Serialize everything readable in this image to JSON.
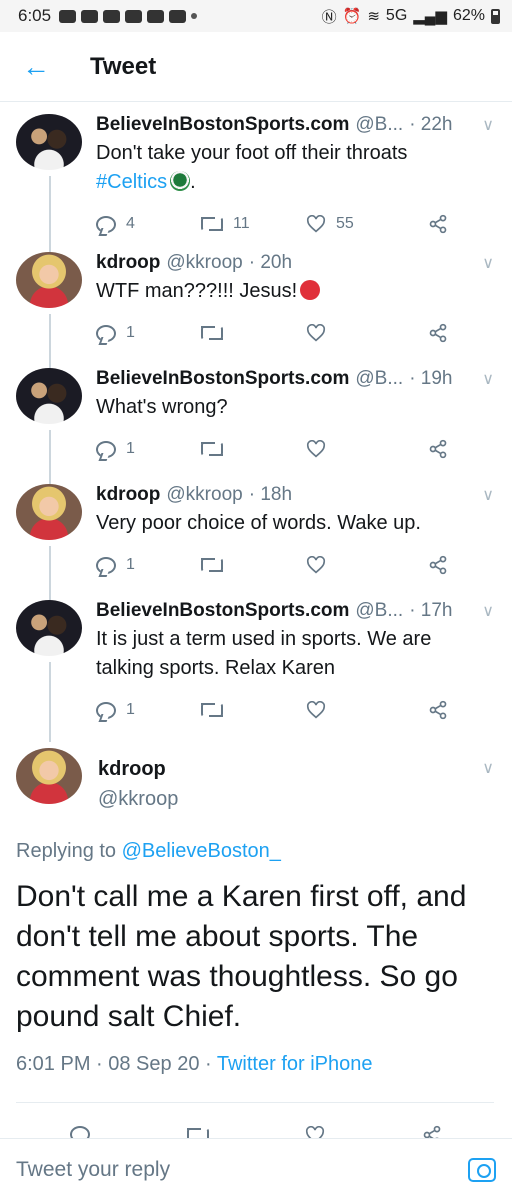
{
  "status_bar": {
    "time": "6:05",
    "network": "5G",
    "battery": "62%"
  },
  "header": {
    "title": "Tweet",
    "back_icon": "arrow-left-icon"
  },
  "thread": [
    {
      "name": "BelieveInBostonSports.com",
      "handle": "@B...",
      "time": "· 22h",
      "text": "Don't take your foot off their throats",
      "hashtag": "#Celtics",
      "text_after": ".",
      "replies": "4",
      "retweets": "11",
      "likes": "55"
    },
    {
      "name": "kdroop",
      "handle": "@kkroop",
      "time": "· 20h",
      "text": "WTF man???!!! Jesus!",
      "replies": "1",
      "retweets": "",
      "likes": ""
    },
    {
      "name": "BelieveInBostonSports.com",
      "handle": "@B...",
      "time": "· 19h",
      "text": "What's wrong?",
      "replies": "1",
      "retweets": "",
      "likes": ""
    },
    {
      "name": "kdroop",
      "handle": "@kkroop",
      "time": "· 18h",
      "text": "Very poor choice of words. Wake up.",
      "replies": "1",
      "retweets": "",
      "likes": ""
    },
    {
      "name": "BelieveInBostonSports.com",
      "handle": "@B...",
      "time": "· 17h",
      "text": "It is just a term used in sports. We are talking sports. Relax Karen",
      "replies": "1",
      "retweets": "",
      "likes": ""
    }
  ],
  "main_tweet": {
    "name": "kdroop",
    "handle": "@kkroop",
    "replying_prefix": "Replying to",
    "replying_to": "@BelieveBoston_",
    "text": "Don't call me a Karen first off, and don't tell me about sports. The comment was thoughtless. So go pound salt Chief.",
    "timestamp": "6:01 PM · 08 Sep 20 · ",
    "source": "Twitter for iPhone"
  },
  "reply_bar": {
    "placeholder": "Tweet your reply"
  },
  "colors": {
    "accent": "#1da1f2",
    "secondary_text": "#657786"
  }
}
